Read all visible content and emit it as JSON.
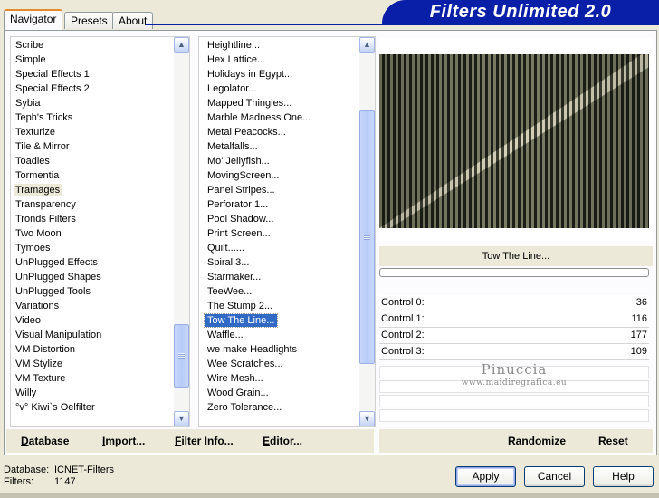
{
  "tabs": [
    {
      "label": "Navigator",
      "active": true
    },
    {
      "label": "Presets",
      "active": false
    },
    {
      "label": "About",
      "active": false
    }
  ],
  "banner": "Filters Unlimited 2.0",
  "categories": {
    "items": [
      "Scribe",
      "Simple",
      "Special Effects 1",
      "Special Effects 2",
      "Sybia",
      "Teph's Tricks",
      "Texturize",
      "Tile & Mirror",
      "Toadies",
      "Tormentia",
      "Tramages",
      "Transparency",
      "Tronds Filters",
      "Two Moon",
      "Tymoes",
      "UnPlugged Effects",
      "UnPlugged Shapes",
      "UnPlugged Tools",
      "Variations",
      "Video",
      "Visual Manipulation",
      "VM Distortion",
      "VM Stylize",
      "VM Texture",
      "Willy",
      "°v° Kiwi`s Oelfilter"
    ],
    "selected": "Tramages",
    "scroll_fraction": 0.92
  },
  "filters": {
    "items": [
      "Heightline...",
      "Hex Lattice...",
      "Holidays in Egypt...",
      "Legolator...",
      "Mapped Thingies...",
      "Marble Madness One...",
      "Metal Peacocks...",
      "Metalfalls...",
      "Mo' Jellyfish...",
      "MovingScreen...",
      "Panel Stripes...",
      "Perforator 1...",
      "Pool Shadow...",
      "Print Screen...",
      "Quilt......",
      "Spiral 3...",
      "Starmaker...",
      "TeeWee...",
      "The Stump 2...",
      "Tow The Line...",
      "Waffle...",
      "we make Headlights",
      "Wee Scratches...",
      "Wire Mesh...",
      "Wood Grain...",
      "Zero Tolerance..."
    ],
    "selected": "Tow The Line...",
    "scroll_fraction": 0.55
  },
  "preview": {
    "filter_name": "Tow The Line...",
    "colors": {
      "dark": "#1e2119",
      "light": "#c9c6ad",
      "mid": "#787a63"
    }
  },
  "controls": [
    {
      "label": "Control 0:",
      "value": "36"
    },
    {
      "label": "Control 1:",
      "value": "116"
    },
    {
      "label": "Control 2:",
      "value": "177"
    },
    {
      "label": "Control 3:",
      "value": "109"
    }
  ],
  "watermark": {
    "line1": "Pinuccia",
    "line2": "www.maidiregrafica.eu"
  },
  "bottom_left_buttons": [
    {
      "label": "Database",
      "key": "D"
    },
    {
      "label": "Import...",
      "key": "I"
    },
    {
      "label": "Filter Info...",
      "key": "F"
    },
    {
      "label": "Editor...",
      "key": "E"
    }
  ],
  "bottom_right_buttons": [
    {
      "label": "Randomize"
    },
    {
      "label": "Reset"
    }
  ],
  "status": {
    "database_label": "Database:",
    "database_value": "ICNET-Filters",
    "filters_label": "Filters:",
    "filters_value": "1147"
  },
  "dialog_buttons": {
    "apply": "Apply",
    "cancel": "Cancel",
    "help": "Help"
  },
  "icons": {
    "scroll_up": "scroll-up-icon",
    "scroll_down": "scroll-down-icon"
  }
}
